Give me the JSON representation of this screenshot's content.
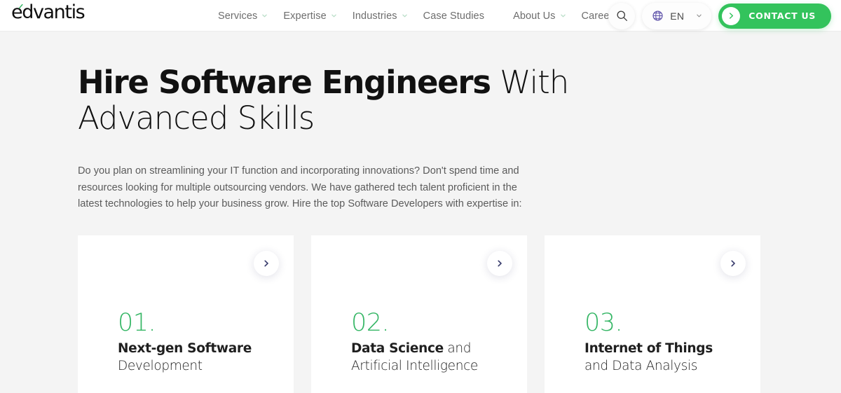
{
  "brand": {
    "logo_text": "edvantis",
    "accent_color": "#33c35c"
  },
  "header": {
    "nav_items": [
      {
        "label": "Services",
        "has_dropdown": true
      },
      {
        "label": "Expertise",
        "has_dropdown": true
      },
      {
        "label": "Industries",
        "has_dropdown": true
      },
      {
        "label": "Case Studies",
        "has_dropdown": false
      },
      {
        "label": "About Us",
        "has_dropdown": true
      },
      {
        "label": "Careers",
        "has_dropdown": false
      }
    ],
    "search_icon": "search-icon",
    "language": {
      "icon": "globe-icon",
      "code": "EN",
      "chevron": "chevron-down-icon"
    },
    "contact_button": {
      "label": "CONTACT US",
      "icon": "arrow-right-icon",
      "background": "#33c35c"
    }
  },
  "hero": {
    "title_bold": "Hire Software Engineers",
    "title_light": " With Advanced Skills",
    "paragraph": "Do you plan on streamlining your IT function and incorporating innovations? Don't spend time and resources looking for multiple outsourcing vendors. We have gathered tech talent proficient in the latest technologies to help your business grow. Hire the top Software Developers with expertise in:"
  },
  "cards": [
    {
      "number": "01.",
      "title_bold": "Next-gen Software",
      "title_light": " Development",
      "arrow_icon": "chevron-right-icon"
    },
    {
      "number": "02.",
      "title_bold": "Data Science",
      "title_light": " and Artificial Intelligence",
      "arrow_icon": "chevron-right-icon"
    },
    {
      "number": "03.",
      "title_bold": "Internet of Things",
      "title_light": " and Data Analysis",
      "arrow_icon": "chevron-right-icon"
    }
  ],
  "colors": {
    "page_background": "#f4f4f4",
    "card_background": "#ffffff",
    "green": "#35b665",
    "brand_green": "#33c35c",
    "chevron_navy": "#363a6b",
    "globe_purple": "#5b4fa8"
  }
}
